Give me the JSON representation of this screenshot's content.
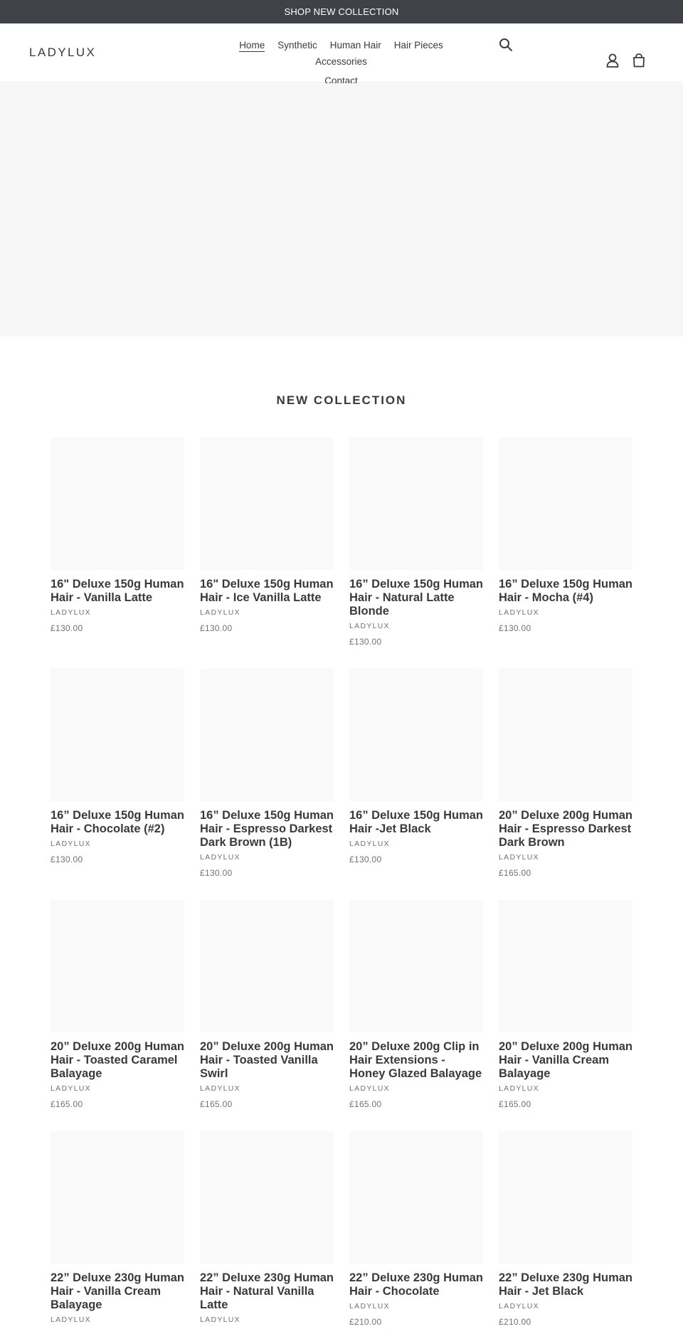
{
  "announcement": {
    "text": "SHOP NEW COLLECTION"
  },
  "header": {
    "logo": "LADYLUX",
    "nav": [
      {
        "label": "Home",
        "active": true
      },
      {
        "label": "Synthetic"
      },
      {
        "label": "Human Hair"
      },
      {
        "label": "Hair Pieces"
      },
      {
        "label": "Accessories"
      },
      {
        "label": "Contact"
      }
    ],
    "icons": {
      "search": "search-icon",
      "account": "account-icon",
      "cart": "cart-icon"
    }
  },
  "collection": {
    "title": "NEW COLLECTION",
    "products": [
      {
        "title": "16\" Deluxe 150g Human Hair - Vanilla Latte",
        "vendor": "LADYLUX",
        "price": "£130.00"
      },
      {
        "title": "16\" Deluxe 150g Human Hair - Ice Vanilla Latte",
        "vendor": "LADYLUX",
        "price": "£130.00"
      },
      {
        "title": "16” Deluxe 150g Human Hair - Natural Latte Blonde",
        "vendor": "LADYLUX",
        "price": "£130.00"
      },
      {
        "title": "16” Deluxe 150g Human Hair - Mocha (#4)",
        "vendor": "LADYLUX",
        "price": "£130.00"
      },
      {
        "title": "16” Deluxe 150g Human Hair - Chocolate (#2)",
        "vendor": "LADYLUX",
        "price": "£130.00"
      },
      {
        "title": "16” Deluxe 150g Human Hair - Espresso Darkest Dark Brown (1B)",
        "vendor": "LADYLUX",
        "price": "£130.00"
      },
      {
        "title": "16” Deluxe 150g Human Hair -Jet Black",
        "vendor": "LADYLUX",
        "price": "£130.00"
      },
      {
        "title": "20” Deluxe 200g Human Hair - Espresso Darkest Dark Brown",
        "vendor": "LADYLUX",
        "price": "£165.00"
      },
      {
        "title": "20” Deluxe 200g Human Hair - Toasted Caramel Balayage",
        "vendor": "LADYLUX",
        "price": "£165.00"
      },
      {
        "title": "20” Deluxe 200g Human Hair - Toasted Vanilla Swirl",
        "vendor": "LADYLUX",
        "price": "£165.00"
      },
      {
        "title": "20” Deluxe 200g Clip in Hair Extensions - Honey Glazed Balayage",
        "vendor": "LADYLUX",
        "price": "£165.00"
      },
      {
        "title": "20” Deluxe 200g Human Hair - Vanilla Cream Balayage",
        "vendor": "LADYLUX",
        "price": "£165.00"
      },
      {
        "title": "22” Deluxe 230g Human Hair - Vanilla Cream Balayage",
        "vendor": "LADYLUX",
        "price": ""
      },
      {
        "title": "22” Deluxe 230g Human Hair - Natural Vanilla Latte",
        "vendor": "LADYLUX",
        "price": ""
      },
      {
        "title": "22” Deluxe 230g Human Hair - Chocolate",
        "vendor": "LADYLUX",
        "price": "£210.00"
      },
      {
        "title": "22” Deluxe 230g Human Hair - Jet Black",
        "vendor": "LADYLUX",
        "price": "£210.00"
      }
    ]
  }
}
